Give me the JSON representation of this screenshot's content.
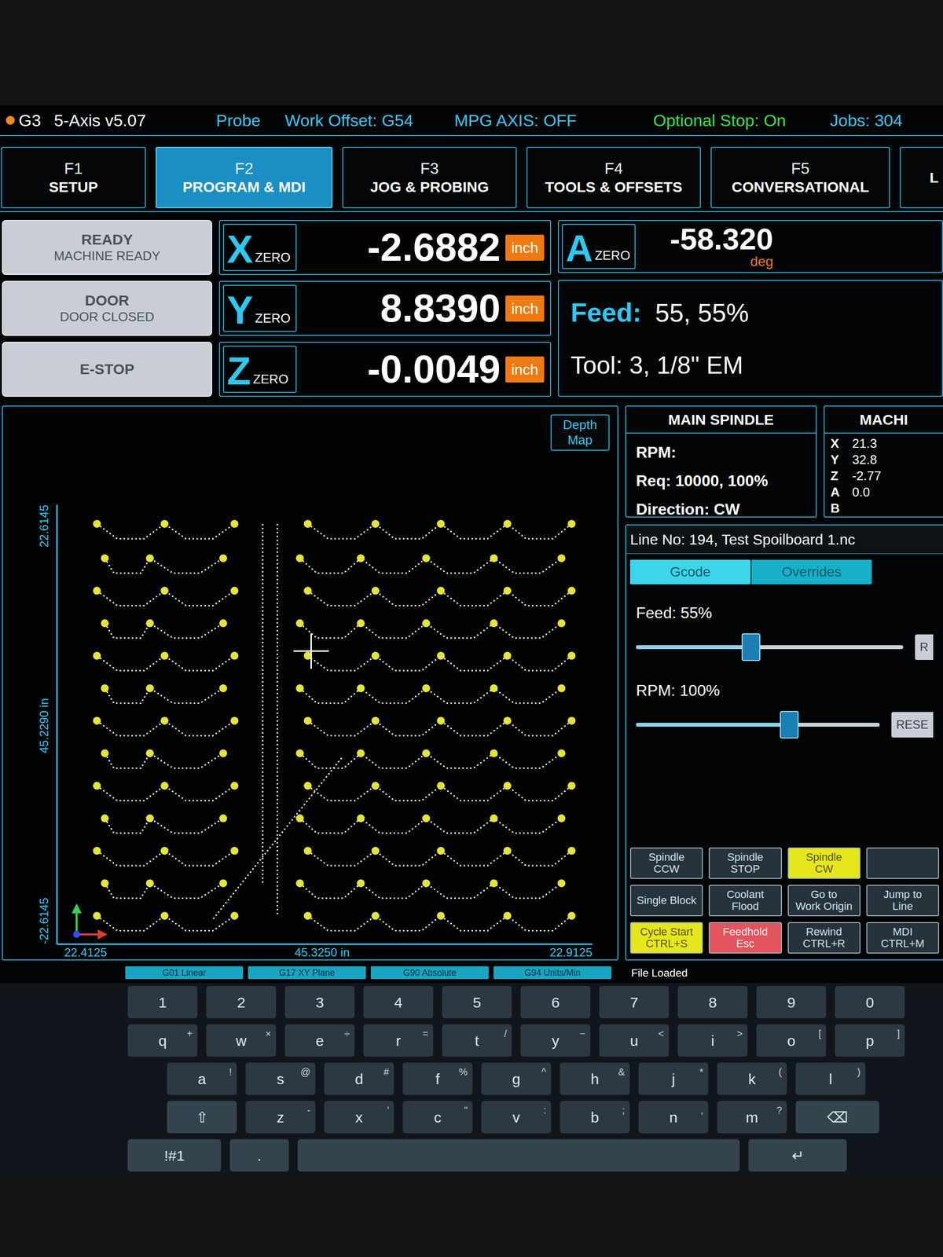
{
  "status_bar": {
    "indicator": {
      "color": "#f08a1a"
    },
    "items": [
      {
        "text": "G3",
        "color": "#ffffff"
      },
      {
        "text": "5-Axis v5.07",
        "color": "#ffffff"
      },
      {
        "text": "Probe",
        "color": "#38c6f0"
      },
      {
        "text": "Work Offset: G54",
        "color": "#38c6f0"
      },
      {
        "text": "MPG AXIS: OFF",
        "color": "#38c6f0"
      },
      {
        "text": "Optional Stop: On",
        "color": "#39e04a"
      },
      {
        "text": "Jobs: 304",
        "color": "#38c6f0"
      }
    ]
  },
  "tabs": [
    {
      "key": "F1",
      "label": "SETUP",
      "selected": false
    },
    {
      "key": "F2",
      "label": "PROGRAM & MDI",
      "selected": true
    },
    {
      "key": "F3",
      "label": "JOG & PROBING",
      "selected": false
    },
    {
      "key": "F4",
      "label": "TOOLS & OFFSETS",
      "selected": false
    },
    {
      "key": "F5",
      "label": "CONVERSATIONAL",
      "selected": false
    },
    {
      "key": "",
      "label": "L",
      "selected": false
    }
  ],
  "status_buttons": [
    {
      "title": "READY",
      "subtitle": "MACHINE READY"
    },
    {
      "title": "DOOR",
      "subtitle": "DOOR CLOSED"
    },
    {
      "title": "E-STOP",
      "subtitle": ""
    }
  ],
  "dro": [
    {
      "axis": "X",
      "label": "ZERO",
      "value": "-2.6882",
      "unit": "inch"
    },
    {
      "axis": "Y",
      "label": "ZERO",
      "value": "8.8390",
      "unit": "inch"
    },
    {
      "axis": "Z",
      "label": "ZERO",
      "value": "-0.0049",
      "unit": "inch"
    }
  ],
  "rotary": {
    "axis": "A",
    "label": "ZERO",
    "value": "-58.320",
    "unit": "deg"
  },
  "feed": {
    "label": "Feed:",
    "value": "55, 55%"
  },
  "tool": {
    "text": "Tool: 3, 1/8\" EM"
  },
  "spindle": {
    "title": "MAIN SPINDLE",
    "lines": [
      "RPM:",
      "Req: 10000, 100%",
      "Direction: CW"
    ]
  },
  "machine": {
    "title": "MACHI",
    "rows": [
      {
        "axis": "X",
        "value": "21.3"
      },
      {
        "axis": "Y",
        "value": "32.8"
      },
      {
        "axis": "Z",
        "value": "-2.77"
      },
      {
        "axis": "A",
        "value": "0.0"
      },
      {
        "axis": "B",
        "value": ""
      }
    ]
  },
  "plot": {
    "depth_map_button": "Depth Map",
    "labels": {
      "y_top": "22.6145",
      "y_span": "45.2290 in",
      "y_bottom": "-22.6145",
      "x_left": "22.4125",
      "x_span": "45.3250 in",
      "x_right": "22.9125"
    },
    "cursor": {
      "x": 20.8,
      "y": 30.5
    },
    "toolpath": {
      "rows": [
        {
          "y": 44.2,
          "left": [
            1.8,
            7.8,
            14.0
          ],
          "right": [
            20.5,
            26.5,
            32.3,
            38.2,
            43.9
          ]
        },
        {
          "y": 40.5,
          "left": [
            2.5,
            6.5,
            13.0
          ],
          "right": [
            19.8,
            25.2,
            31.0,
            37.0,
            43.0
          ]
        },
        {
          "y": 37.0,
          "left": [
            1.8,
            7.8,
            14.0
          ],
          "right": [
            20.5,
            26.5,
            32.3,
            38.2,
            43.9
          ]
        },
        {
          "y": 33.5,
          "left": [
            2.5,
            6.5,
            13.0
          ],
          "right": [
            19.8,
            25.2,
            31.0,
            37.0,
            43.0
          ]
        },
        {
          "y": 30.0,
          "left": [
            1.8,
            7.8,
            14.0
          ],
          "right": [
            20.5,
            26.5,
            32.3,
            38.2,
            43.9
          ]
        },
        {
          "y": 26.5,
          "left": [
            2.5,
            6.5,
            13.0
          ],
          "right": [
            19.8,
            25.2,
            31.0,
            37.0,
            43.0
          ]
        },
        {
          "y": 23.0,
          "left": [
            1.8,
            7.8,
            14.0
          ],
          "right": [
            20.5,
            26.5,
            32.3,
            38.2,
            43.9
          ]
        },
        {
          "y": 19.5,
          "left": [
            2.5,
            6.5,
            13.0
          ],
          "right": [
            19.8,
            25.2,
            31.0,
            37.0,
            43.0
          ]
        },
        {
          "y": 16.0,
          "left": [
            1.8,
            7.8,
            14.0
          ],
          "right": [
            20.5,
            26.5,
            32.3,
            38.2,
            43.9
          ]
        },
        {
          "y": 12.5,
          "left": [
            2.5,
            6.5,
            13.0
          ],
          "right": [
            19.8,
            25.2,
            31.0,
            37.0,
            43.0
          ]
        },
        {
          "y": 9.0,
          "left": [
            1.8,
            7.8,
            14.0
          ],
          "right": [
            20.5,
            26.5,
            32.3,
            38.2,
            43.9
          ]
        },
        {
          "y": 5.5,
          "left": [
            2.5,
            6.5,
            13.0
          ],
          "right": [
            19.8,
            25.2,
            31.0,
            37.0,
            43.0
          ]
        },
        {
          "y": 2.0,
          "left": [
            1.8,
            7.8,
            14.0
          ],
          "right": [
            20.5,
            26.5,
            32.3,
            38.2,
            43.9
          ]
        }
      ],
      "lines": [
        {
          "x1": 16.5,
          "y1": 44.2,
          "x2": 16.5,
          "y2": 5.5
        },
        {
          "x1": 17.8,
          "y1": 44.2,
          "x2": 17.8,
          "y2": 2.0
        },
        {
          "x1": 23.5,
          "y1": 19.0,
          "x2": 12.0,
          "y2": 1.5
        }
      ]
    }
  },
  "program": {
    "header": "Line No: 194, Test Spoilboard 1.nc",
    "tabs": [
      {
        "label": "Gcode",
        "selected": true
      },
      {
        "label": "Overrides",
        "selected": false
      }
    ],
    "sliders": [
      {
        "label": "Feed: 55%",
        "level": 0.43,
        "button": "R"
      },
      {
        "label": "RPM: 100%",
        "level": 0.63,
        "button": "RESE"
      }
    ],
    "buttons": [
      {
        "lines": [
          "Spindle",
          "CCW"
        ],
        "color": "#26333b"
      },
      {
        "lines": [
          "Spindle",
          "STOP"
        ],
        "color": "#26333b"
      },
      {
        "lines": [
          "Spindle",
          "CW"
        ],
        "color": "#e6e61c"
      },
      {
        "lines": [],
        "color": "#26333b"
      },
      {
        "lines": [
          "Single Block"
        ],
        "color": "#26333b"
      },
      {
        "lines": [
          "Coolant",
          "Flood"
        ],
        "color": "#26333b"
      },
      {
        "lines": [
          "Go to",
          "Work Origin"
        ],
        "color": "#26333b"
      },
      {
        "lines": [
          "Jump to",
          "Line"
        ],
        "color": "#26333b"
      },
      {
        "lines": [
          "Cycle Start",
          "CTRL+S"
        ],
        "color": "#e6e61c"
      },
      {
        "lines": [
          "Feedhold",
          "Esc"
        ],
        "color": "#e2545e"
      },
      {
        "lines": [
          "Rewind",
          "CTRL+R"
        ],
        "color": "#26333b"
      },
      {
        "lines": [
          "MDI",
          "CTRL+M"
        ],
        "color": "#26333b"
      }
    ]
  },
  "mode_chips": [
    "G01 Linear",
    "G17 XY Plane",
    "G90 Absolute",
    "G94 Units/Min"
  ],
  "file_status": "File Loaded",
  "keyboard": [
    [
      {
        "label": "1",
        "alt": "",
        "kind": "key"
      },
      {
        "label": "2",
        "alt": "",
        "kind": "key"
      },
      {
        "label": "3",
        "alt": "",
        "kind": "key"
      },
      {
        "label": "4",
        "alt": "",
        "kind": "key"
      },
      {
        "label": "5",
        "alt": "",
        "kind": "key"
      },
      {
        "label": "6",
        "alt": "",
        "kind": "key"
      },
      {
        "label": "7",
        "alt": "",
        "kind": "key"
      },
      {
        "label": "8",
        "alt": "",
        "kind": "key"
      },
      {
        "label": "9",
        "alt": "",
        "kind": "key"
      },
      {
        "label": "0",
        "alt": "",
        "kind": "key"
      }
    ],
    [
      {
        "label": "q",
        "alt": "+",
        "kind": "key"
      },
      {
        "label": "w",
        "alt": "×",
        "kind": "key"
      },
      {
        "label": "e",
        "alt": "÷",
        "kind": "key"
      },
      {
        "label": "r",
        "alt": "=",
        "kind": "key"
      },
      {
        "label": "t",
        "alt": "/",
        "kind": "key"
      },
      {
        "label": "y",
        "alt": "−",
        "kind": "key"
      },
      {
        "label": "u",
        "alt": "<",
        "kind": "key"
      },
      {
        "label": "i",
        "alt": ">",
        "kind": "key"
      },
      {
        "label": "o",
        "alt": "[",
        "kind": "key"
      },
      {
        "label": "p",
        "alt": "]",
        "kind": "key"
      }
    ],
    [
      {
        "label": "a",
        "alt": "!",
        "kind": "key"
      },
      {
        "label": "s",
        "alt": "@",
        "kind": "key"
      },
      {
        "label": "d",
        "alt": "#",
        "kind": "key"
      },
      {
        "label": "f",
        "alt": "%",
        "kind": "key"
      },
      {
        "label": "g",
        "alt": "^",
        "kind": "key"
      },
      {
        "label": "h",
        "alt": "&",
        "kind": "key"
      },
      {
        "label": "j",
        "alt": "*",
        "kind": "key"
      },
      {
        "label": "k",
        "alt": "(",
        "kind": "key"
      },
      {
        "label": "l",
        "alt": ")",
        "kind": "key"
      }
    ],
    [
      {
        "label": "⇧",
        "alt": "",
        "kind": "shift"
      },
      {
        "label": "z",
        "alt": "-",
        "kind": "key"
      },
      {
        "label": "x",
        "alt": "'",
        "kind": "key"
      },
      {
        "label": "c",
        "alt": "\"",
        "kind": "key"
      },
      {
        "label": "v",
        "alt": ":",
        "kind": "key"
      },
      {
        "label": "b",
        "alt": ";",
        "kind": "key"
      },
      {
        "label": "n",
        "alt": ",",
        "kind": "key"
      },
      {
        "label": "m",
        "alt": "?",
        "kind": "key"
      },
      {
        "label": "⌫",
        "alt": "",
        "kind": "backspace"
      }
    ],
    [
      {
        "label": "!#1",
        "alt": "",
        "kind": "mode"
      },
      {
        "label": ".",
        "alt": "",
        "kind": "punct"
      },
      {
        "label": "",
        "alt": "",
        "kind": "space"
      },
      {
        "label": "↵",
        "alt": "",
        "kind": "enter"
      }
    ]
  ]
}
